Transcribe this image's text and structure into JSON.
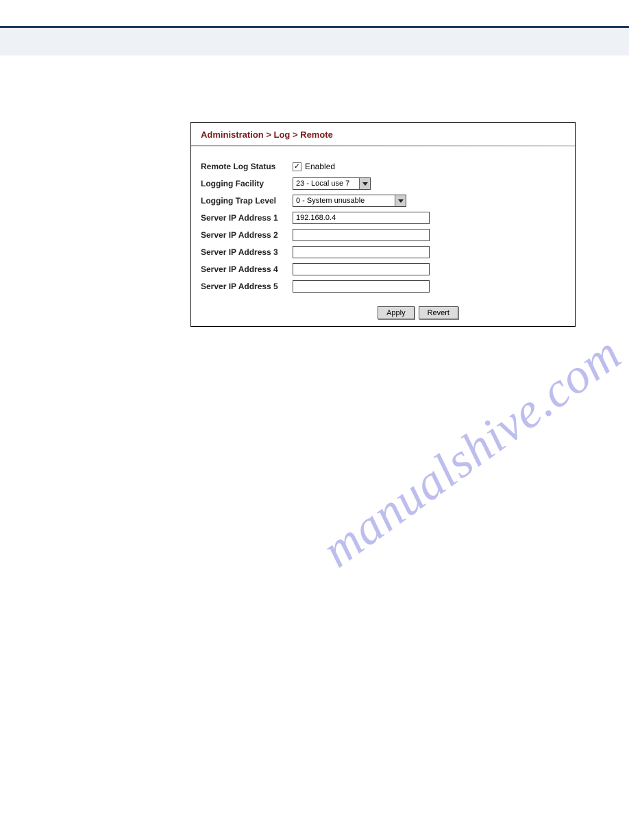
{
  "header": {},
  "panel": {
    "breadcrumb": "Administration > Log > Remote",
    "fields": {
      "remoteLogStatus": {
        "label": "Remote Log Status",
        "checked": true,
        "checkboxLabel": "Enabled"
      },
      "loggingFacility": {
        "label": "Logging Facility",
        "selected": "23 - Local use 7"
      },
      "loggingTrapLevel": {
        "label": "Logging Trap Level",
        "selected": "0 - System unusable"
      },
      "serverIp1": {
        "label": "Server IP Address 1",
        "value": "192.168.0.4"
      },
      "serverIp2": {
        "label": "Server IP Address 2",
        "value": ""
      },
      "serverIp3": {
        "label": "Server IP Address 3",
        "value": ""
      },
      "serverIp4": {
        "label": "Server IP Address 4",
        "value": ""
      },
      "serverIp5": {
        "label": "Server IP Address 5",
        "value": ""
      }
    },
    "buttons": {
      "apply": "Apply",
      "revert": "Revert"
    }
  },
  "watermark": "manualshive.com"
}
